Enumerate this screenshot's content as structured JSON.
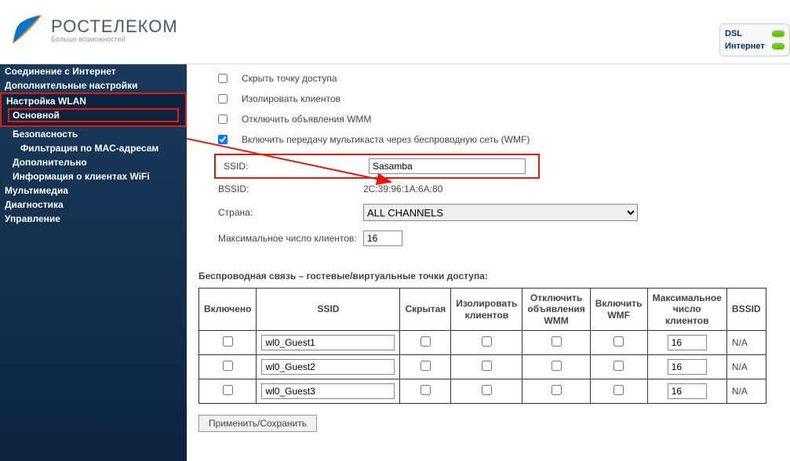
{
  "brand": {
    "name": "РОСТЕЛЕКОМ",
    "tagline": "Больше возможностей"
  },
  "status": {
    "dsl": "DSL",
    "internet": "Интернет"
  },
  "sidebar": {
    "items": [
      "Соединение с Интернет",
      "Дополнительные настройки",
      "Настройка WLAN",
      "Основной",
      "Безопасность",
      "Фильтрация по MAC-адресам",
      "Дополнительно",
      "Информация о клиентах WiFi",
      "Мультимедиа",
      "Диагностика",
      "Управление"
    ]
  },
  "options": {
    "hide_ap": "Скрыть точку доступа",
    "isolate": "Изолировать клиентов",
    "disable_wmm": "Отключить объявления WMM",
    "wmf": "Включить передачу мультикаста через беспроводную сеть (WMF)",
    "ssid_label": "SSID:",
    "ssid_value": "Sasamba",
    "bssid_label": "BSSID:",
    "bssid_value": "2C:39:96:1A:6A:80",
    "country_label": "Страна:",
    "country_value": "ALL CHANNELS",
    "maxclients_label": "Максимальное число клиентов:",
    "maxclients_value": "16"
  },
  "guest": {
    "title": "Беспроводная связь – гостевые/виртуальные точки доступа:",
    "headers": {
      "enabled": "Включено",
      "ssid": "SSID",
      "hidden": "Скрытая",
      "isolate": "Изолировать клиентов",
      "disable_wmm": "Отключить объявления WMM",
      "wmf": "Включить WMF",
      "maxclients": "Максимальное число клиентов",
      "bssid": "BSSID"
    },
    "rows": [
      {
        "ssid": "wl0_Guest1",
        "max": "16",
        "bssid": "N/A"
      },
      {
        "ssid": "wl0_Guest2",
        "max": "16",
        "bssid": "N/A"
      },
      {
        "ssid": "wl0_Guest3",
        "max": "16",
        "bssid": "N/A"
      }
    ]
  },
  "save_button": "Применить/Сохранить"
}
